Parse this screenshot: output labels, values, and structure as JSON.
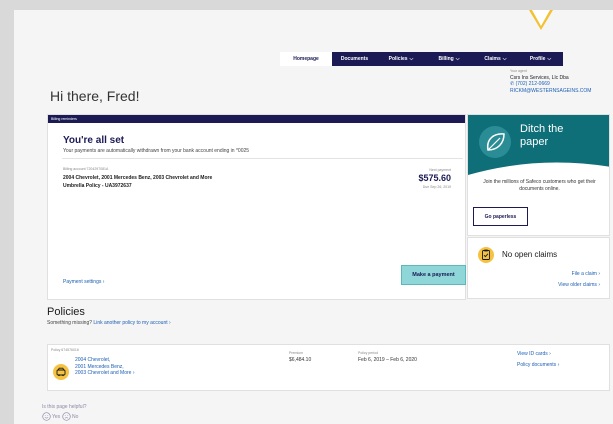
{
  "nav": {
    "tabs": [
      {
        "label": "Homepage",
        "active": true
      },
      {
        "label": "Documents",
        "chevron": false
      },
      {
        "label": "Policies",
        "chevron": true
      },
      {
        "label": "Billing",
        "chevron": true
      },
      {
        "label": "Claims",
        "chevron": true
      },
      {
        "label": "Profile",
        "chevron": true
      }
    ]
  },
  "agent": {
    "label": "Your agent",
    "name": "Csrs Ins Services, Llc Dba",
    "phone": "(702) 212-0669",
    "email": "RICKM@WESTERNSAGEINS.COM"
  },
  "greeting": "Hi there, Fred!",
  "billing": {
    "header": "Billing reminders",
    "title": "You're all set",
    "subtitle": "Your payments are automatically withdrawn from your bank account ending in *0025",
    "account_label": "Billing account 7204297081A",
    "policy_line1": "2004 Chevrolet, 2001 Mercedes Benz, 2003 Chevrolet and More",
    "policy_line2": "Umbrella Policy - UA3972637",
    "next_payment_label": "Next payment",
    "next_payment_amount": "$575.60",
    "due_date": "Due Sep 26, 2019",
    "payment_settings": "Payment settings ›",
    "make_payment": "Make a payment"
  },
  "paperless": {
    "title_line1": "Ditch the",
    "title_line2": "paper",
    "description": "Join the millions of Safeco customers who get their documents online.",
    "button": "Go paperless"
  },
  "claims": {
    "title": "No open claims",
    "file_claim": "File a claim ›",
    "view_older": "View older claims ›"
  },
  "policies": {
    "title": "Policies",
    "missing_text": "Something missing?",
    "missing_link": "Link another policy to my account ›",
    "card": {
      "policy_number": "Policy 674576016",
      "vehicles": [
        "2004 Chevrolet,",
        "2001 Mercedes Benz,",
        "2003 Chevrolet and More ›"
      ],
      "premium_label": "Premium",
      "premium": "$6,484.10",
      "period_label": "Policy period",
      "period": "Feb 6, 2019 – Feb 6, 2020",
      "view_id_cards": "View ID cards ›",
      "policy_documents": "Policy documents ›"
    }
  },
  "feedback": {
    "question": "Is this page helpful?",
    "yes": "Yes",
    "no": "No"
  },
  "colors": {
    "navy": "#1b1a55",
    "teal": "#0f6f78",
    "link": "#1a5fb4",
    "yellow": "#f5c242",
    "button_teal": "#8ed6d8"
  }
}
